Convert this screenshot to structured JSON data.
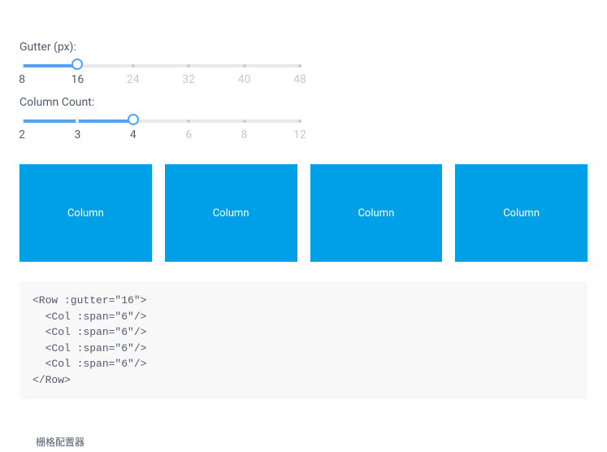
{
  "gutter": {
    "label": "Gutter (px):",
    "value": 16,
    "marks": [
      8,
      16,
      24,
      32,
      40,
      48
    ],
    "min": 8,
    "max": 48,
    "fill_percent": 20
  },
  "column_count": {
    "label": "Column Count:",
    "value": 4,
    "marks": [
      2,
      3,
      4,
      6,
      8,
      12
    ],
    "fill_percent": 40
  },
  "column_label": "Column",
  "code": "<Row :gutter=\"16\">\n  <Col :span=\"6\"/>\n  <Col :span=\"6\"/>\n  <Col :span=\"6\"/>\n  <Col :span=\"6\"/>\n</Row>",
  "footer_text": "栅格配置器",
  "colors": {
    "column_bg": "#00a0e9",
    "slider_active": "#57a3f3"
  }
}
